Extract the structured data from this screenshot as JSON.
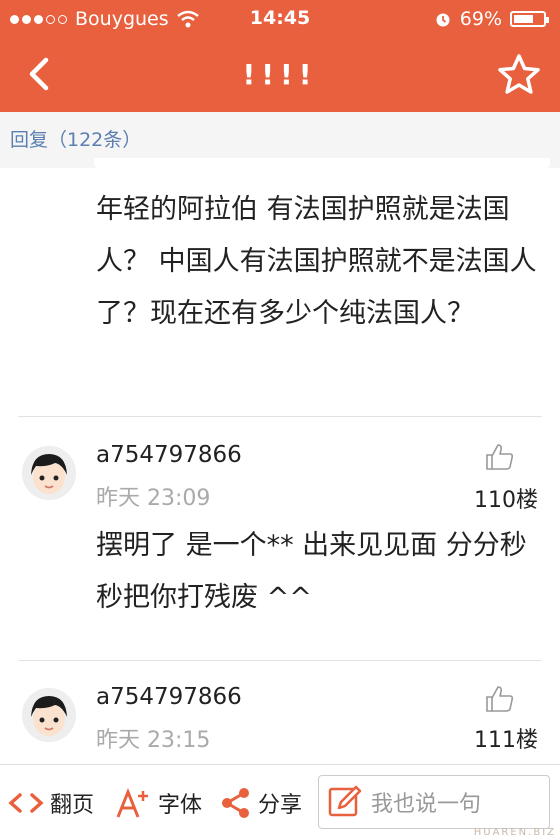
{
  "status_bar": {
    "carrier": "Bouygues",
    "time": "14:45",
    "battery": "69%",
    "battery_level": 0.69
  },
  "nav": {
    "title": "!!!!"
  },
  "replies": {
    "label": "回复（122条）"
  },
  "quoted_post": {
    "text": "年轻的阿拉伯 有法国护照就是法国人？ 中国人有法国护照就不是法国人了？现在还有多少个纯法国人？"
  },
  "posts": [
    {
      "username": "a754797866",
      "timestamp": "昨天 23:09",
      "floor": "110楼",
      "text": "摆明了 是一个** 出来见见面 分分秒秒把你打残废 ^^"
    },
    {
      "username": "a754797866",
      "timestamp": "昨天 23:15",
      "floor": "111楼",
      "text": ""
    }
  ],
  "toolbar": {
    "page_label": "翻页",
    "font_label": "字体",
    "share_label": "分享",
    "compose_placeholder": "我也说一句"
  },
  "watermark": "HUAREN.BIZ",
  "colors": {
    "brand": "#e8603e",
    "link": "#5a7fb0"
  }
}
